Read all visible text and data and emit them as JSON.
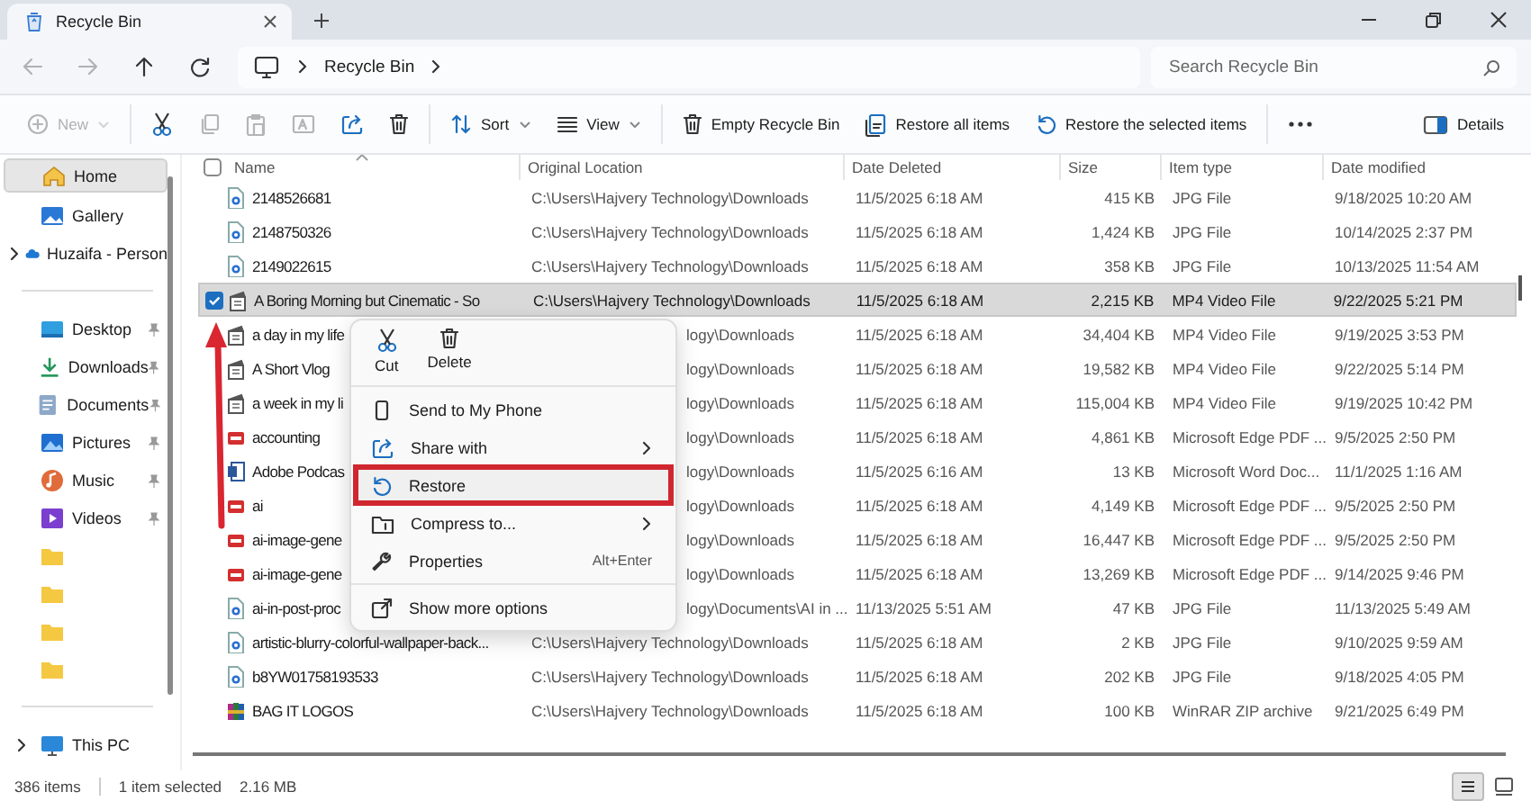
{
  "window": {
    "tab_title": "Recycle Bin"
  },
  "address_bar": {
    "path": [
      "Recycle Bin"
    ],
    "search": {
      "placeholder": "Search Recycle Bin"
    }
  },
  "navigation": [
    {
      "kind": "back",
      "disabled": true
    },
    {
      "kind": "forward",
      "disabled": true
    },
    {
      "kind": "up",
      "disabled": false
    },
    {
      "kind": "refresh",
      "disabled": false
    }
  ],
  "command_bar": {
    "items": [
      {
        "kind": "new",
        "label": "New",
        "dropdown": true,
        "disabled": true
      },
      {
        "kind": "separator"
      },
      {
        "kind": "cut",
        "disabled": false
      },
      {
        "kind": "copy",
        "disabled": true
      },
      {
        "kind": "paste",
        "disabled": true
      },
      {
        "kind": "rename",
        "disabled": true
      },
      {
        "kind": "share",
        "disabled": false
      },
      {
        "kind": "delete",
        "disabled": false
      },
      {
        "kind": "separator"
      },
      {
        "kind": "sort",
        "label": "Sort",
        "dropdown": true,
        "disabled": false
      },
      {
        "kind": "view",
        "label": "View",
        "dropdown": true,
        "disabled": false
      },
      {
        "kind": "separator"
      },
      {
        "kind": "empty",
        "label": "Empty Recycle Bin",
        "disabled": false
      },
      {
        "kind": "restore_all",
        "label": "Restore all items",
        "disabled": false
      },
      {
        "kind": "restore",
        "label": "Restore the selected items",
        "disabled": false
      },
      {
        "kind": "separator"
      },
      {
        "kind": "more",
        "disabled": false
      },
      {
        "kind": "spacer"
      },
      {
        "kind": "details",
        "label": "Details",
        "disabled": false
      }
    ]
  },
  "sidebar": {
    "items": [
      {
        "kind": "home",
        "label": "Home",
        "selected": true
      },
      {
        "kind": "gallery",
        "label": "Gallery",
        "selected": false
      },
      {
        "kind": "cloud",
        "label": "Huzaifa - Person",
        "selected": false,
        "expandable": true
      },
      {
        "kind": "divider"
      },
      {
        "kind": "desktop",
        "label": "Desktop",
        "selected": false,
        "pinned": true
      },
      {
        "kind": "downloads",
        "label": "Downloads",
        "selected": false,
        "pinned": true
      },
      {
        "kind": "documents",
        "label": "Documents",
        "selected": false,
        "pinned": true
      },
      {
        "kind": "pictures",
        "label": "Pictures",
        "selected": false,
        "pinned": true
      },
      {
        "kind": "music",
        "label": "Music",
        "selected": false,
        "pinned": true
      },
      {
        "kind": "videos",
        "label": "Videos",
        "selected": false,
        "pinned": true
      },
      {
        "kind": "folder",
        "selected": false
      },
      {
        "kind": "folder",
        "selected": false
      },
      {
        "kind": "folder",
        "selected": false
      },
      {
        "kind": "folder",
        "selected": false
      },
      {
        "kind": "divider"
      },
      {
        "kind": "pc",
        "label": "This PC",
        "selected": false,
        "expandable": true
      }
    ]
  },
  "table": {
    "header_checked": false,
    "columns": [
      "Name",
      "Original Location",
      "Date Deleted",
      "Size",
      "Item type",
      "Date modified"
    ],
    "rows": [
      {
        "kind": "jpg",
        "name": "2148526681",
        "location": "C:\\Users\\Hajvery Technology\\Downloads",
        "deleted": "11/5/2025 6:18 AM",
        "size": "415 KB",
        "type": "JPG File",
        "modified": "9/18/2025 10:20 AM",
        "selected": false,
        "under_menu": false
      },
      {
        "kind": "jpg",
        "name": "2148750326",
        "location": "C:\\Users\\Hajvery Technology\\Downloads",
        "deleted": "11/5/2025 6:18 AM",
        "size": "1,424 KB",
        "type": "JPG File",
        "modified": "10/14/2025 2:37 PM",
        "selected": false,
        "under_menu": false
      },
      {
        "kind": "jpg",
        "name": "2149022615",
        "location": "C:\\Users\\Hajvery Technology\\Downloads",
        "deleted": "11/5/2025 6:18 AM",
        "size": "358 KB",
        "type": "JPG File",
        "modified": "10/13/2025 11:54 AM",
        "selected": false,
        "under_menu": false
      },
      {
        "kind": "video",
        "name": "A Boring Morning but Cinematic - So",
        "location": "C:\\Users\\Hajvery Technology\\Downloads",
        "deleted": "11/5/2025 6:18 AM",
        "size": "2,215 KB",
        "type": "MP4 Video File",
        "modified": "9/22/2025 5:21 PM",
        "selected": true,
        "under_menu": false
      },
      {
        "kind": "video",
        "name": "a day in my life",
        "location": "logy\\Downloads",
        "deleted": "11/5/2025 6:18 AM",
        "size": "34,404 KB",
        "type": "MP4 Video File",
        "modified": "9/19/2025 3:53 PM",
        "selected": false,
        "under_menu": true
      },
      {
        "kind": "video",
        "name": "A Short Vlog",
        "location": "logy\\Downloads",
        "deleted": "11/5/2025 6:18 AM",
        "size": "19,582 KB",
        "type": "MP4 Video File",
        "modified": "9/22/2025 5:14 PM",
        "selected": false,
        "under_menu": true
      },
      {
        "kind": "video",
        "name": "a week in my li",
        "location": "logy\\Downloads",
        "deleted": "11/5/2025 6:18 AM",
        "size": "115,004 KB",
        "type": "MP4 Video File",
        "modified": "9/19/2025 10:42 PM",
        "selected": false,
        "under_menu": true
      },
      {
        "kind": "pdf",
        "name": "accounting",
        "location": "logy\\Downloads",
        "deleted": "11/5/2025 6:18 AM",
        "size": "4,861 KB",
        "type": "Microsoft Edge PDF ...",
        "modified": "9/5/2025 2:50 PM",
        "selected": false,
        "under_menu": true
      },
      {
        "kind": "doc",
        "name": "Adobe Podcas",
        "location": "logy\\Downloads",
        "deleted": "11/5/2025 6:16 AM",
        "size": "13 KB",
        "type": "Microsoft Word Doc...",
        "modified": "11/1/2025 1:16 AM",
        "selected": false,
        "under_menu": true
      },
      {
        "kind": "pdf",
        "name": "ai",
        "location": "logy\\Downloads",
        "deleted": "11/5/2025 6:18 AM",
        "size": "4,149 KB",
        "type": "Microsoft Edge PDF ...",
        "modified": "9/5/2025 2:50 PM",
        "selected": false,
        "under_menu": true
      },
      {
        "kind": "pdf",
        "name": "ai-image-gene",
        "location": "logy\\Downloads",
        "deleted": "11/5/2025 6:18 AM",
        "size": "16,447 KB",
        "type": "Microsoft Edge PDF ...",
        "modified": "9/5/2025 2:50 PM",
        "selected": false,
        "under_menu": true
      },
      {
        "kind": "pdf",
        "name": "ai-image-gene",
        "location": "logy\\Downloads",
        "deleted": "11/5/2025 6:18 AM",
        "size": "13,269 KB",
        "type": "Microsoft Edge PDF ...",
        "modified": "9/14/2025 9:46 PM",
        "selected": false,
        "under_menu": true
      },
      {
        "kind": "jpg",
        "name": "ai-in-post-proc",
        "location": "logy\\Documents\\AI in ...",
        "deleted": "11/13/2025 5:51 AM",
        "size": "47 KB",
        "type": "JPG File",
        "modified": "11/13/2025 5:49 AM",
        "selected": false,
        "under_menu": true
      },
      {
        "kind": "jpg",
        "name": "artistic-blurry-colorful-wallpaper-back...",
        "location": "C:\\Users\\Hajvery Technology\\Downloads",
        "deleted": "11/5/2025 6:18 AM",
        "size": "2 KB",
        "type": "JPG File",
        "modified": "9/10/2025 9:59 AM",
        "selected": false,
        "under_menu": false
      },
      {
        "kind": "jpg",
        "name": "b8YW01758193533",
        "location": "C:\\Users\\Hajvery Technology\\Downloads",
        "deleted": "11/5/2025 6:18 AM",
        "size": "202 KB",
        "type": "JPG File",
        "modified": "9/18/2025 4:05 PM",
        "selected": false,
        "under_menu": false
      },
      {
        "kind": "zip",
        "name": "BAG IT LOGOS",
        "location": "C:\\Users\\Hajvery Technology\\Downloads",
        "deleted": "11/5/2025 6:18 AM",
        "size": "100 KB",
        "type": "WinRAR ZIP archive",
        "modified": "9/21/2025 6:49 PM",
        "selected": false,
        "under_menu": false
      }
    ]
  },
  "context_menu": {
    "quick_actions": [
      {
        "kind": "cut",
        "label": "Cut"
      },
      {
        "kind": "delete",
        "label": "Delete"
      }
    ],
    "items": [
      {
        "kind": "phone",
        "label": "Send to My Phone",
        "submenu": false,
        "highlighted": false
      },
      {
        "kind": "share",
        "label": "Share with",
        "submenu": true,
        "highlighted": false
      },
      {
        "kind": "restore",
        "label": "Restore",
        "submenu": false,
        "highlighted": true
      },
      {
        "kind": "compress",
        "label": "Compress to...",
        "submenu": true,
        "highlighted": false
      },
      {
        "kind": "properties",
        "label": "Properties",
        "shortcut": "Alt+Enter",
        "submenu": false,
        "highlighted": false
      },
      {
        "kind": "divider"
      },
      {
        "kind": "more",
        "label": "Show more options",
        "submenu": false,
        "highlighted": false
      }
    ]
  },
  "status_bar": {
    "count": "386 items",
    "selection": "1 item selected",
    "selection_size": "2.16 MB",
    "views": [
      {
        "kind": "details",
        "selected": true
      },
      {
        "kind": "tiles",
        "selected": false
      }
    ]
  }
}
